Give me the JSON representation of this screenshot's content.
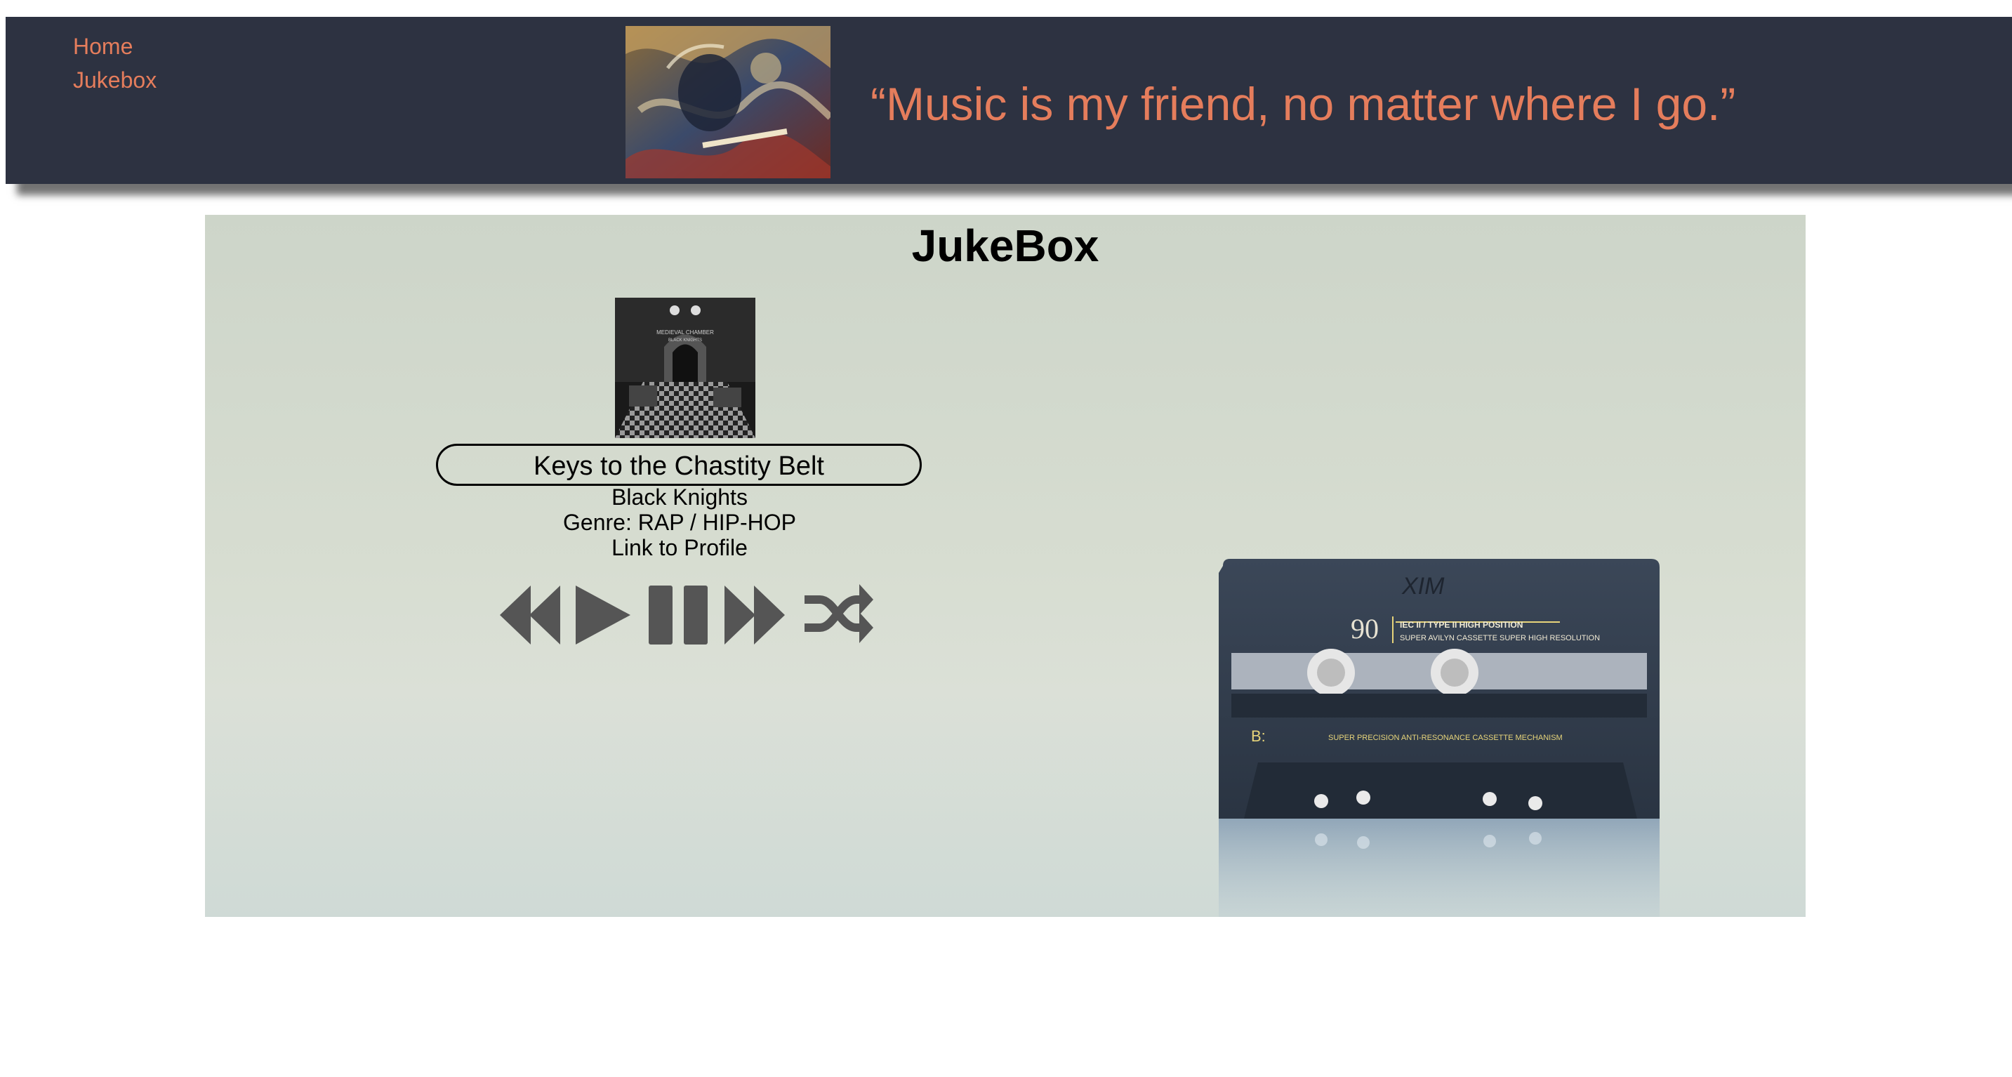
{
  "nav": {
    "home_label": "Home",
    "jukebox_label": "Jukebox"
  },
  "header": {
    "quote": "“Music is my friend, no matter where I go.”"
  },
  "jukebox": {
    "title": "JukeBox",
    "song_title": "Keys to the Chastity Belt",
    "artist": "Black Knights",
    "genre": "Genre: RAP / HIP-HOP",
    "profile_link": "Link to Profile",
    "album_art_text": [
      "MEDIEVAL CHAMBER",
      "BLACK KNIGHTS"
    ]
  },
  "controls": {
    "icons": [
      "rewind-icon",
      "play-icon",
      "pause-icon",
      "fast-forward-icon",
      "shuffle-icon"
    ]
  },
  "cassette": {
    "label_number": "90",
    "label_line1": "IEC II / TYPE II  HIGH POSITION",
    "label_line2": "SUPER AVILYN CASSETTE SUPER HIGH RESOLUTION",
    "side": "B:",
    "mechanism": "SUPER PRECISION ANTI-RESONANCE CASSETTE MECHANISM",
    "handwriting": "XIM"
  },
  "colors": {
    "header_bg": "#2d3241",
    "accent": "#e57d5c",
    "control_icon": "#555555"
  }
}
